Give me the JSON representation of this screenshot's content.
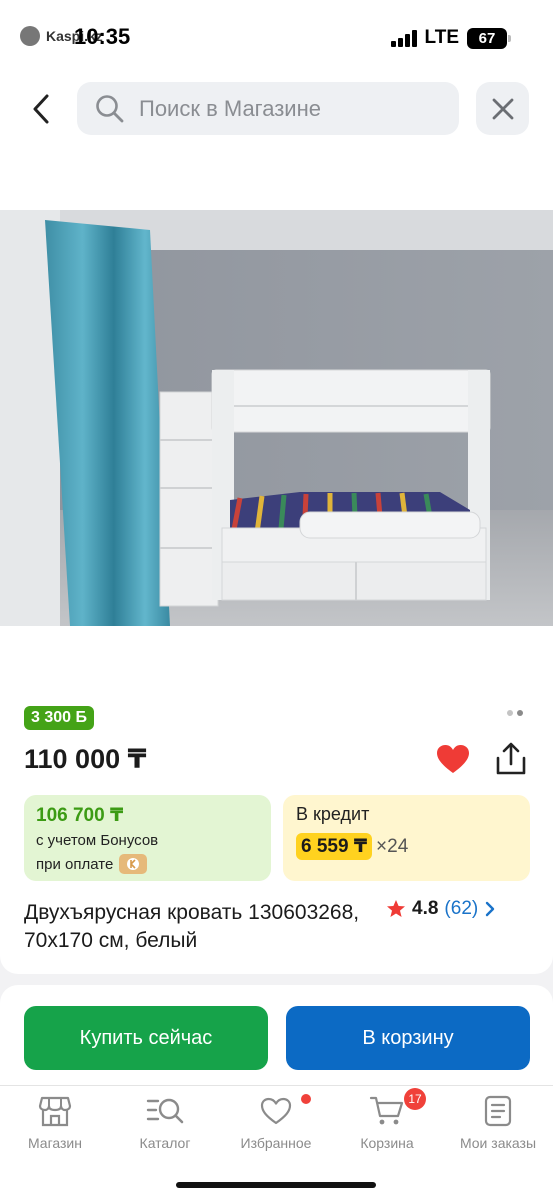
{
  "status_bar": {
    "back_app": "Kaspi.kz",
    "time": "10:35",
    "network": "LTE",
    "battery": "67"
  },
  "top_bar": {
    "search_placeholder": "Поиск в Магазине"
  },
  "product": {
    "bonus_badge": "3 300 Б",
    "price": "110 000 ₸",
    "bonus_card": {
      "amount": "106 700 ₸",
      "line1": "с учетом Бонусов",
      "line2": "при оплате"
    },
    "credit_card": {
      "title": "В кредит",
      "monthly": "6 559 ₸",
      "multiplier": "×24"
    },
    "title": "Двухъярусная кровать 130603268, 70x170 см, белый",
    "rating": "4.8",
    "reviews": "(62)",
    "image_pager": {
      "total": 2,
      "active": 1
    },
    "favorite": true
  },
  "actions": {
    "buy_now": "Купить сейчас",
    "add_to_cart": "В корзину"
  },
  "bottom_nav": {
    "items": [
      {
        "label": "Магазин",
        "icon": "store-icon"
      },
      {
        "label": "Каталог",
        "icon": "catalog-search-icon"
      },
      {
        "label": "Избранное",
        "icon": "heart-outline-icon"
      },
      {
        "label": "Корзина",
        "icon": "cart-icon"
      },
      {
        "label": "Мои заказы",
        "icon": "orders-icon"
      }
    ],
    "cart_count": "17"
  },
  "colors": {
    "green_accent": "#44a317",
    "buy_button": "#16a34a",
    "cart_button": "#0c6ac4",
    "credit_highlight": "#ffd21f",
    "heart": "#ef3b36",
    "link_blue": "#1a73c9"
  }
}
